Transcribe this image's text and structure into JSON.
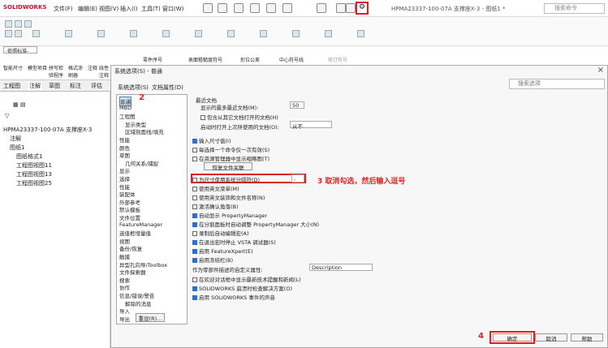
{
  "app": {
    "logo": "SOLIDWORKS",
    "menus": [
      "文件(F)",
      "编辑(E)",
      "视图(V)",
      "插入(I)",
      "工具(T)",
      "窗口(W)"
    ],
    "doc_title": "HPMA23337-100-07A 支撑座X-3 - 图纸1 *",
    "search": "搜索命令"
  },
  "toolbar": {
    "standard_label": "-依照标准-",
    "commands": [
      "智能尺寸",
      "模型项目",
      "拼写检验程序",
      "格式涂刷器",
      "注释",
      "线性注释阵列",
      "零件序号",
      "表面粗糙度符号",
      "形位公差",
      "中心符号线",
      "修订符号"
    ]
  },
  "tabs": [
    "工程图",
    "注解",
    "草图",
    "标注",
    "评估"
  ],
  "tree": {
    "root": "HPMA23337-100-07A 支撑座X-3",
    "items": [
      "注解",
      "图纸1",
      "图纸格式1",
      "工程图视图11",
      "工程图视图13",
      "工程图视图25"
    ]
  },
  "dialog": {
    "title": "系统选项(S) - 普通",
    "close": "×",
    "tab_system": "系统选项(S)",
    "tab_doc": "文档属性(D)",
    "search_placeholder": "搜索选项",
    "nav": [
      "普通",
      "MBD",
      "工程图",
      "显示类型",
      "区域剖面线/填充",
      "性能",
      "颜色",
      "草图",
      "几何关系/捕捉",
      "显示",
      "选择",
      "性能",
      "装配体",
      "外部参考",
      "默认模板",
      "文件位置",
      "FeatureManager",
      "选值框增量值",
      "视图",
      "备份/恢复",
      "触摸",
      "异型孔向导/Toolbox",
      "文件探索器",
      "搜索",
      "协作",
      "信息/错误/警告",
      "解除的消息",
      "导入",
      "导出"
    ],
    "reset_btn": "重设(R)...",
    "recent_docs_label": "最近文档",
    "recent_max_label": "显示的最多最近文档(M):",
    "recent_max_value": "50",
    "include_folder": "包含从其它文档打开的文档(H)",
    "open_last_label": "启动时打开上次所使用的文档(O):",
    "open_last_value": "从不",
    "opt_input_dim": "输入尺寸值(I)",
    "opt_single_cmd": "每选择一个命令仅一次有效(S)",
    "opt_show_thumb": "在资源管理器中显示缩略图(T)",
    "restore_assoc": "恢复文件关联",
    "opt_sys_sep": "为尺寸使用系统分隔符(D)",
    "sys_sep_value": ",",
    "opt_eng_menu": "使用英文菜单(M)",
    "opt_eng_feat": "使用英文装饰和文件名称(N)",
    "opt_confirm": "激活确认角落(B)",
    "opt_auto_fm": "自动显示 PropertyManager",
    "opt_split": "在分割面板时自动调整 PropertyManager 大小(N)",
    "opt_macro": "录制后自动编辑宏(A)",
    "opt_vsta": "在退出宏时停止 VSTA 调试器(S)",
    "opt_featurexpert": "启用 FeatureXpert(E)",
    "opt_freeze": "启用冻结栏(B)",
    "desc_label": "作为零部件描述的自定义属性:",
    "desc_value": "Description",
    "opt_welcome": "在欢迎对话框中显示最新技术提醒和新闻(L)",
    "opt_rx": "SOLIDWORKS 崩溃时检查解决方案(O)",
    "opt_sound": "启用 SOLIDWORKS 事件的声音",
    "ok": "确定",
    "cancel": "取消",
    "help": "帮助"
  },
  "annotations": {
    "n1": "1",
    "n2": "2",
    "n3": "3  取消勾选，然后输入逗号",
    "n4": "4"
  },
  "colors": {
    "annotation_red": "#e02020",
    "selected_blue": "#2a6fd6"
  }
}
